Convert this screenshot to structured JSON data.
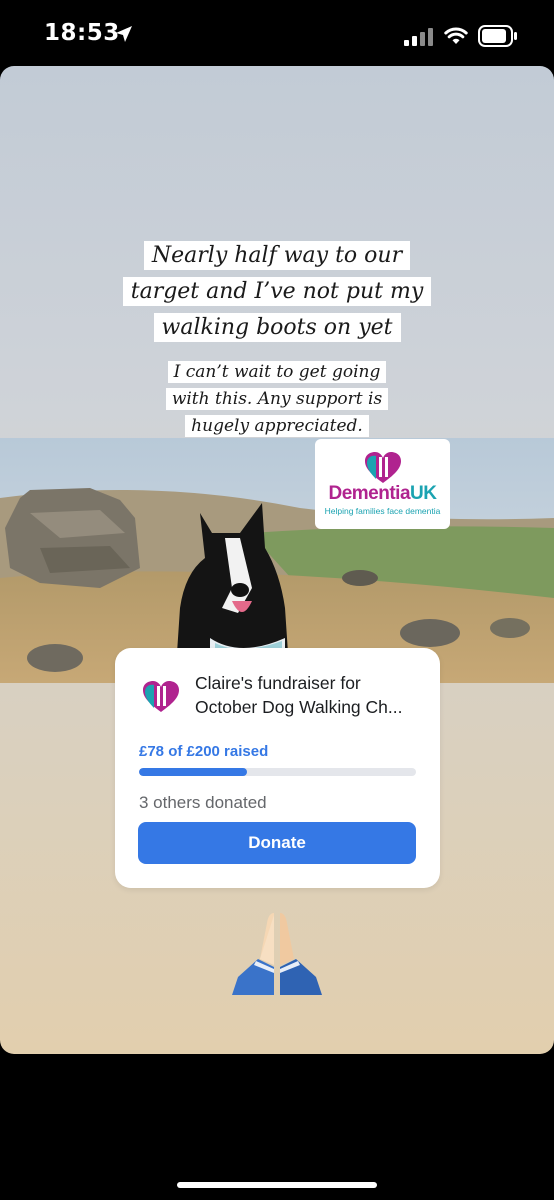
{
  "status_bar": {
    "time": "18:53"
  },
  "story": {
    "headline_lines": [
      "Nearly half way to our",
      "target and I’ve not put my",
      "walking boots on yet"
    ],
    "subtext_lines": [
      "I can’t wait to get going",
      "with this. Any support is",
      "hugely appreciated."
    ],
    "logo": {
      "name_part1": "Dementia",
      "name_part2": "UK",
      "tagline": "Helping families face dementia",
      "colors": {
        "magenta": "#b0238f",
        "teal": "#1ba3b1"
      }
    },
    "fundraiser": {
      "title": "Claire's fundraiser for October Dog Walking Ch...",
      "raised_text": "£78 of £200 raised",
      "raised_amount": 78,
      "target_amount": 200,
      "progress_fraction": 0.39,
      "donors_text": "3 others donated",
      "donate_label": "Donate",
      "accent_color": "#3578e5"
    },
    "emoji": "praying-hands"
  }
}
